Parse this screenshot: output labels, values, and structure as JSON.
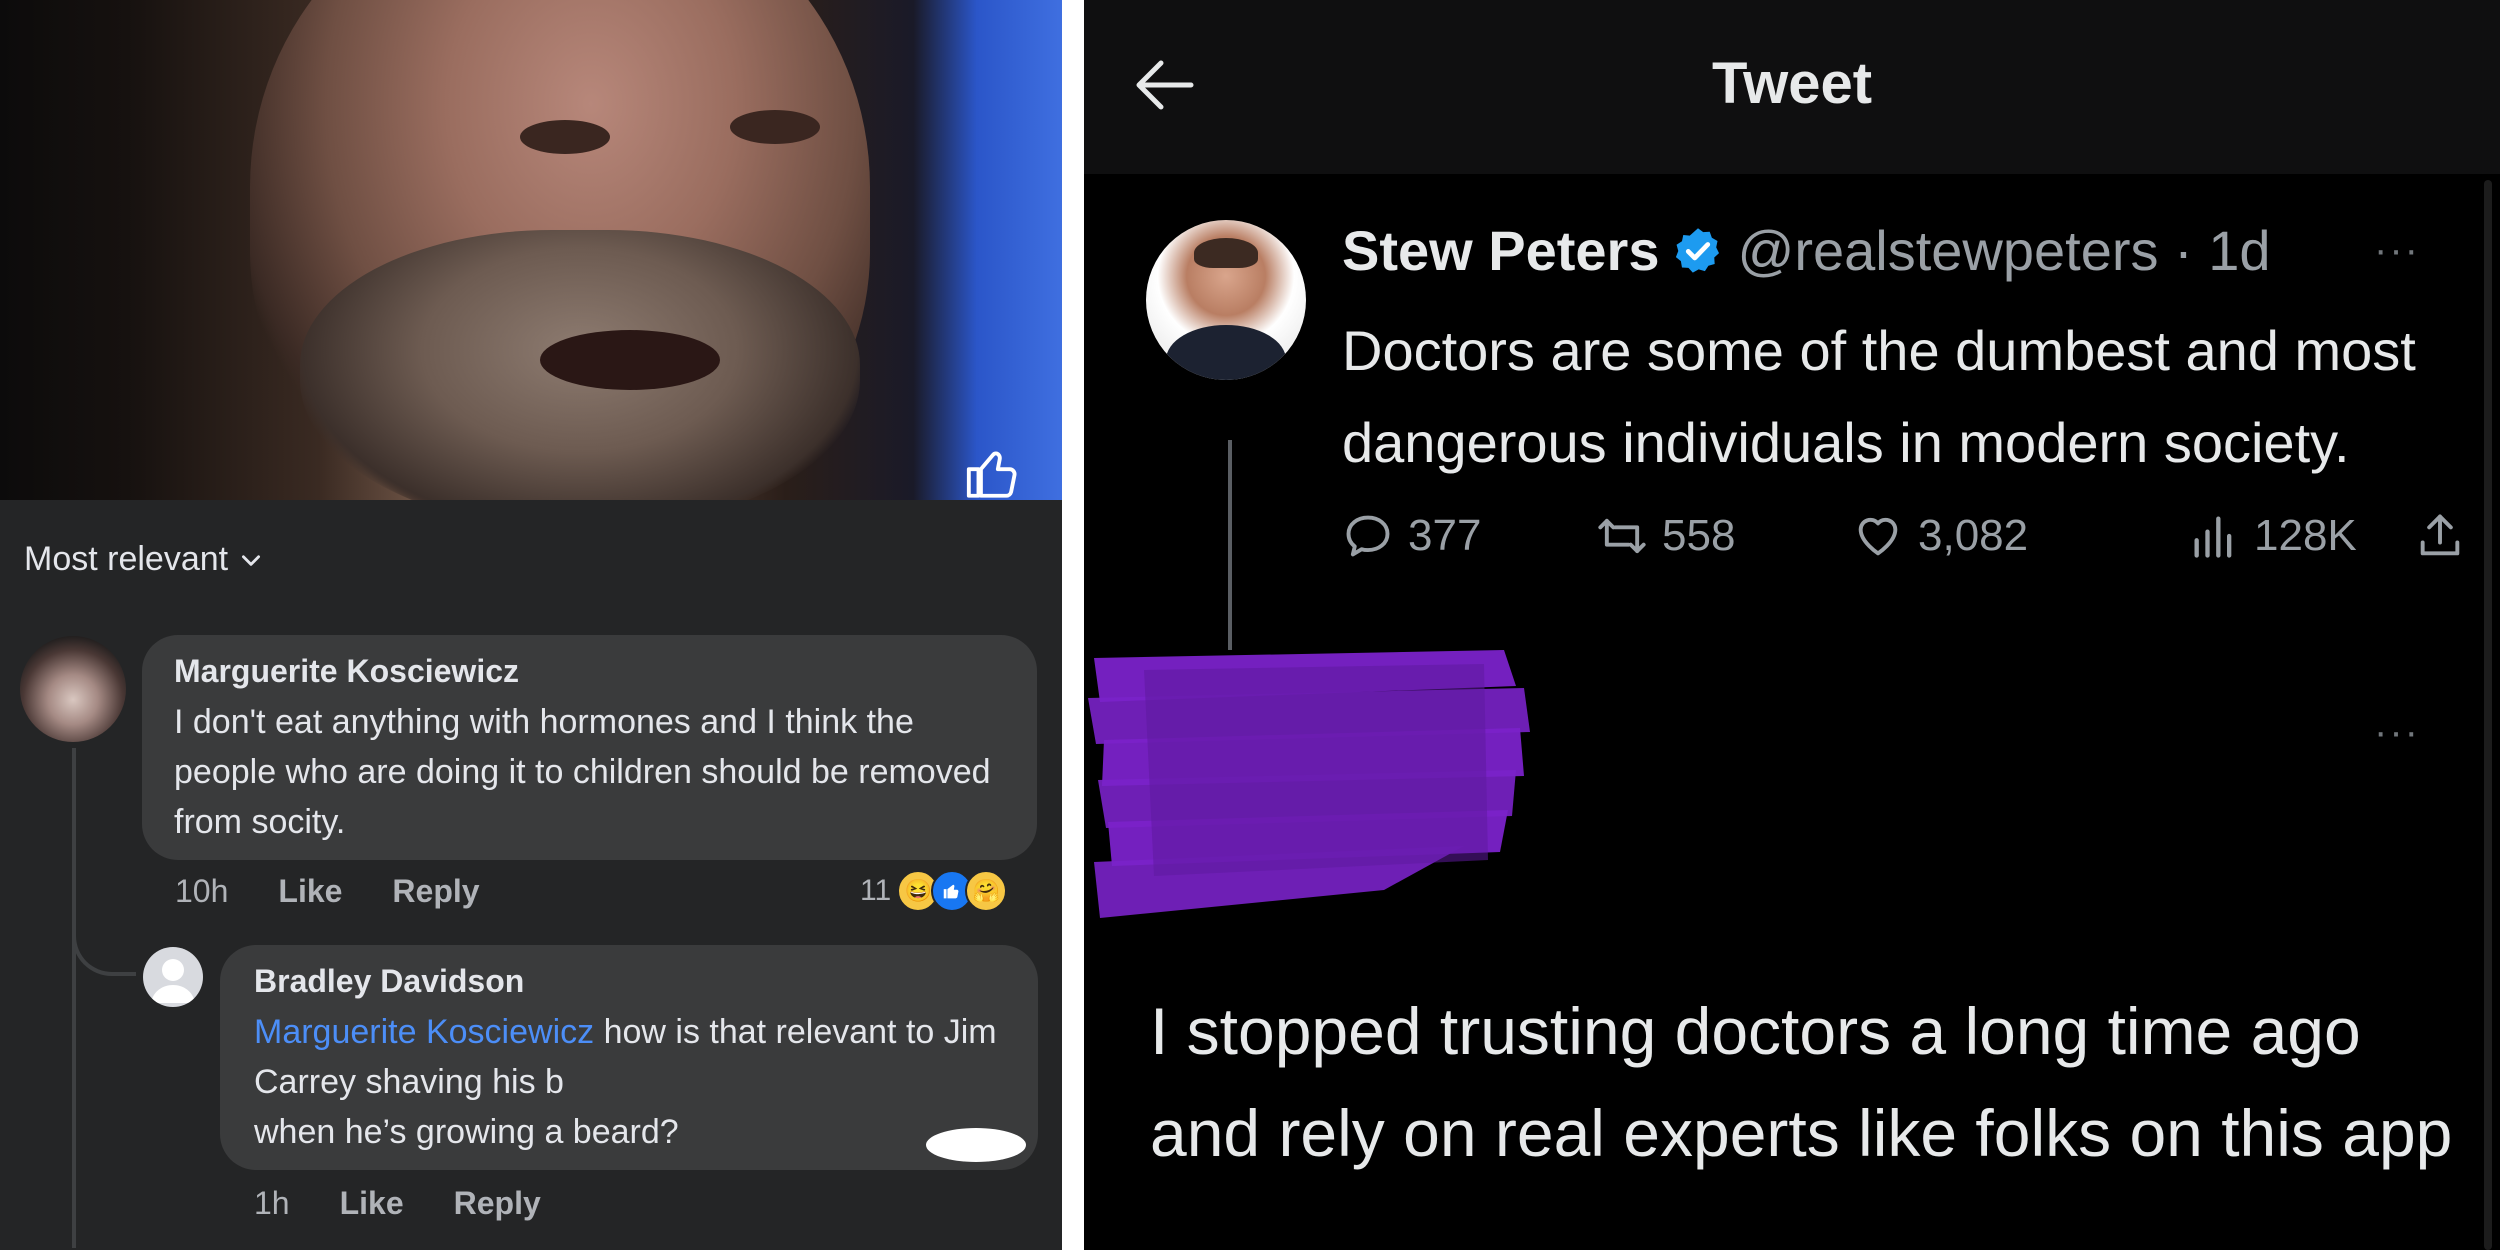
{
  "left": {
    "sort_label": "Most relevant",
    "comments": [
      {
        "author": "Marguerite Kosciewicz",
        "text": "I don't eat anything with hormones and I think the people who are doing it to children should be removed from socity.",
        "time": "10h",
        "like_label": "Like",
        "reply_label": "Reply",
        "reaction_count": "11"
      },
      {
        "author": "Bradley Davidson",
        "mention": "Marguerite Kosciewicz",
        "text_after_mention": " how is that relevant to Jim Carrey shaving his b",
        "text_end": "when he’s growing a beard?",
        "time": "1h",
        "like_label": "Like",
        "reply_label": "Reply"
      }
    ],
    "colors": {
      "panel_bg": "#242526",
      "bubble_bg": "#3a3b3c",
      "mention": "#4c8ef7"
    }
  },
  "right": {
    "title": "Tweet",
    "tweet": {
      "display_name": "Stew Peters",
      "handle_time": "@realstewpeters · 1d",
      "text": "Doctors are some of the dumbest and most dangerous individuals in modern society.",
      "replies": "377",
      "retweets": "558",
      "likes": "3,082",
      "views": "128K"
    },
    "reply_text": "I stopped trusting doctors a long time ago and rely on real experts like folks on this app",
    "more_label": "···",
    "colors": {
      "bg": "#000000",
      "verified": "#1d9bf0",
      "redaction": "#7a22c9"
    }
  }
}
